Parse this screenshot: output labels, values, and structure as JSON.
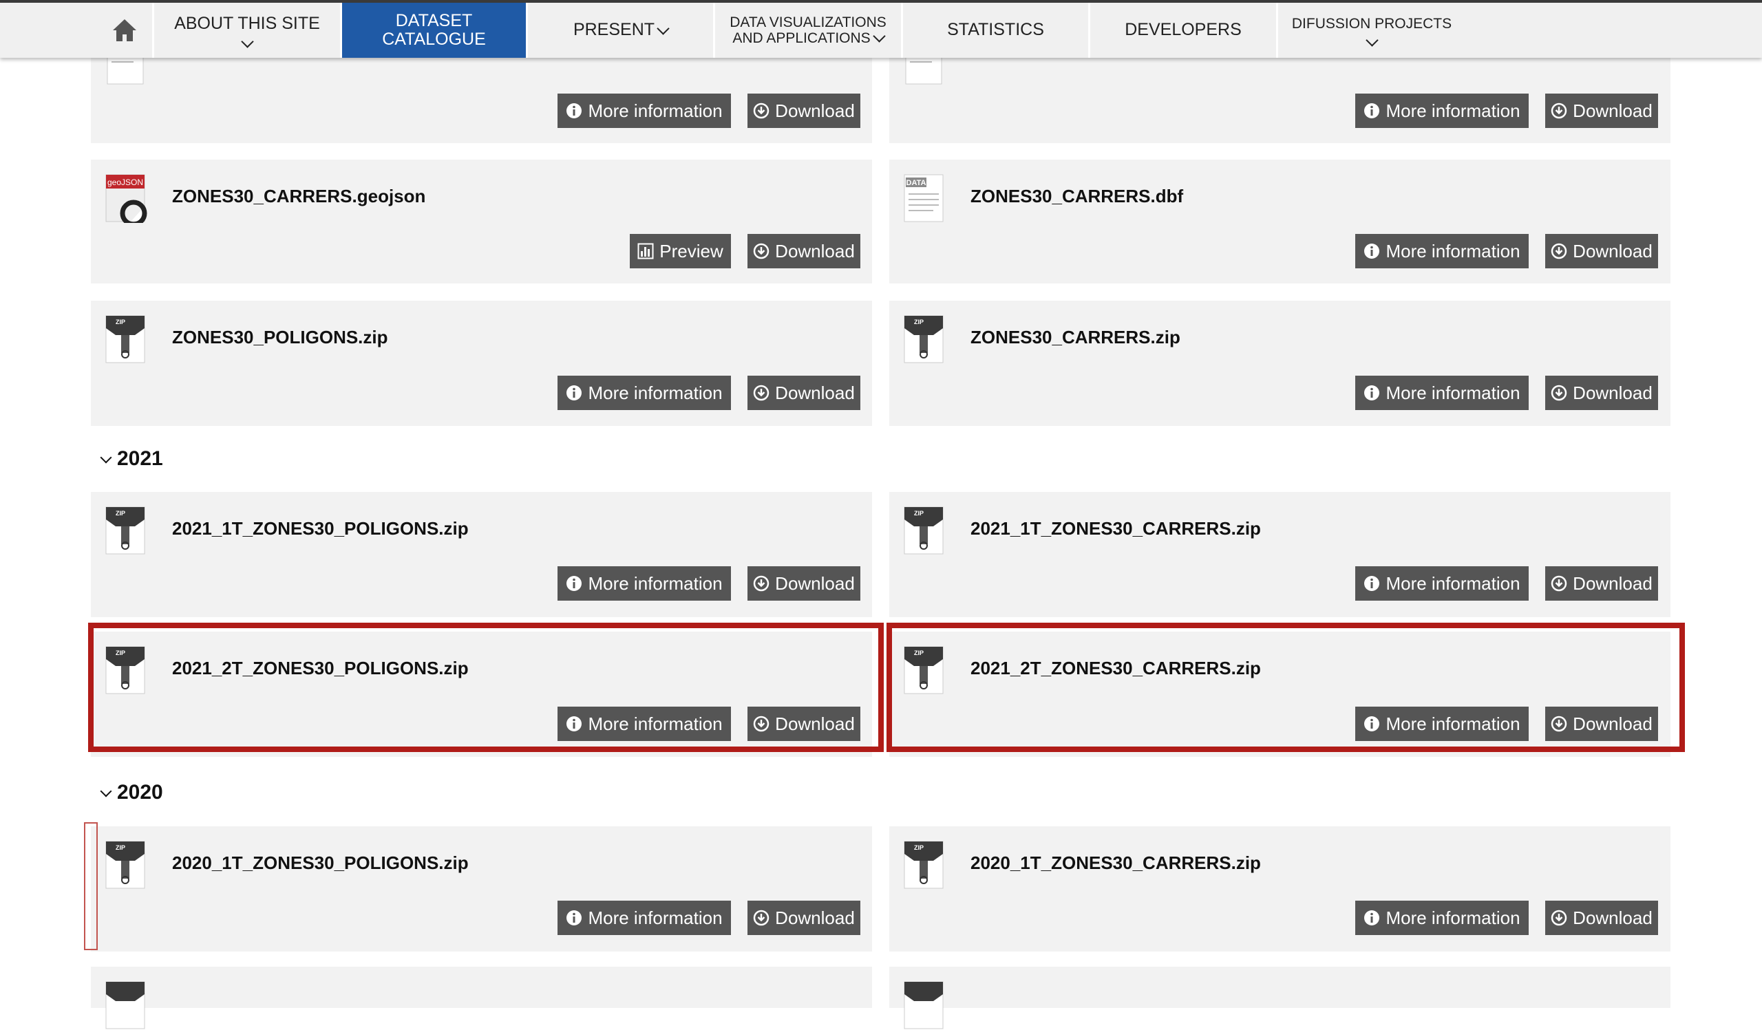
{
  "nav": {
    "home_icon": "home-icon",
    "items": [
      {
        "line1": "ABOUT THIS SITE"
      },
      {
        "line1": "DATASET",
        "line2": "CATALOGUE"
      },
      {
        "line1": "PRESENT"
      },
      {
        "line1": "DATA VISUALIZATIONS",
        "line2": "AND APPLICATIONS"
      },
      {
        "line1": "STATISTICS"
      },
      {
        "line1": "DEVELOPERS"
      },
      {
        "line1": "DIFUSSION PROJECTS"
      }
    ],
    "active_color": "#1f5aa6"
  },
  "buttons": {
    "more_info": "More information",
    "download": "Download",
    "preview": "Preview"
  },
  "files": {
    "top_left": "",
    "top_right": "",
    "geojson": "ZONES30_CARRERS.geojson",
    "dbf": "ZONES30_CARRERS.dbf",
    "poligons": "ZONES30_POLIGONS.zip",
    "carrers": "ZONES30_CARRERS.zip",
    "y2021_1t_pol": "2021_1T_ZONES30_POLIGONS.zip",
    "y2021_1t_car": "2021_1T_ZONES30_CARRERS.zip",
    "y2021_2t_pol": "2021_2T_ZONES30_POLIGONS.zip",
    "y2021_2t_car": "2021_2T_ZONES30_CARRERS.zip",
    "y2020_1t_pol": "2020_1T_ZONES30_POLIGONS.zip",
    "y2020_1t_car": "2020_1T_ZONES30_CARRERS.zip"
  },
  "icon_labels": {
    "geojson": "geoJSON",
    "dbf": "DATA",
    "zip": "ZIP"
  },
  "sections": {
    "y2021": "2021",
    "y2020": "2020"
  },
  "colors": {
    "button_bg": "#555555",
    "card_bg": "#f2f2f2",
    "highlight": "#b01c18"
  }
}
